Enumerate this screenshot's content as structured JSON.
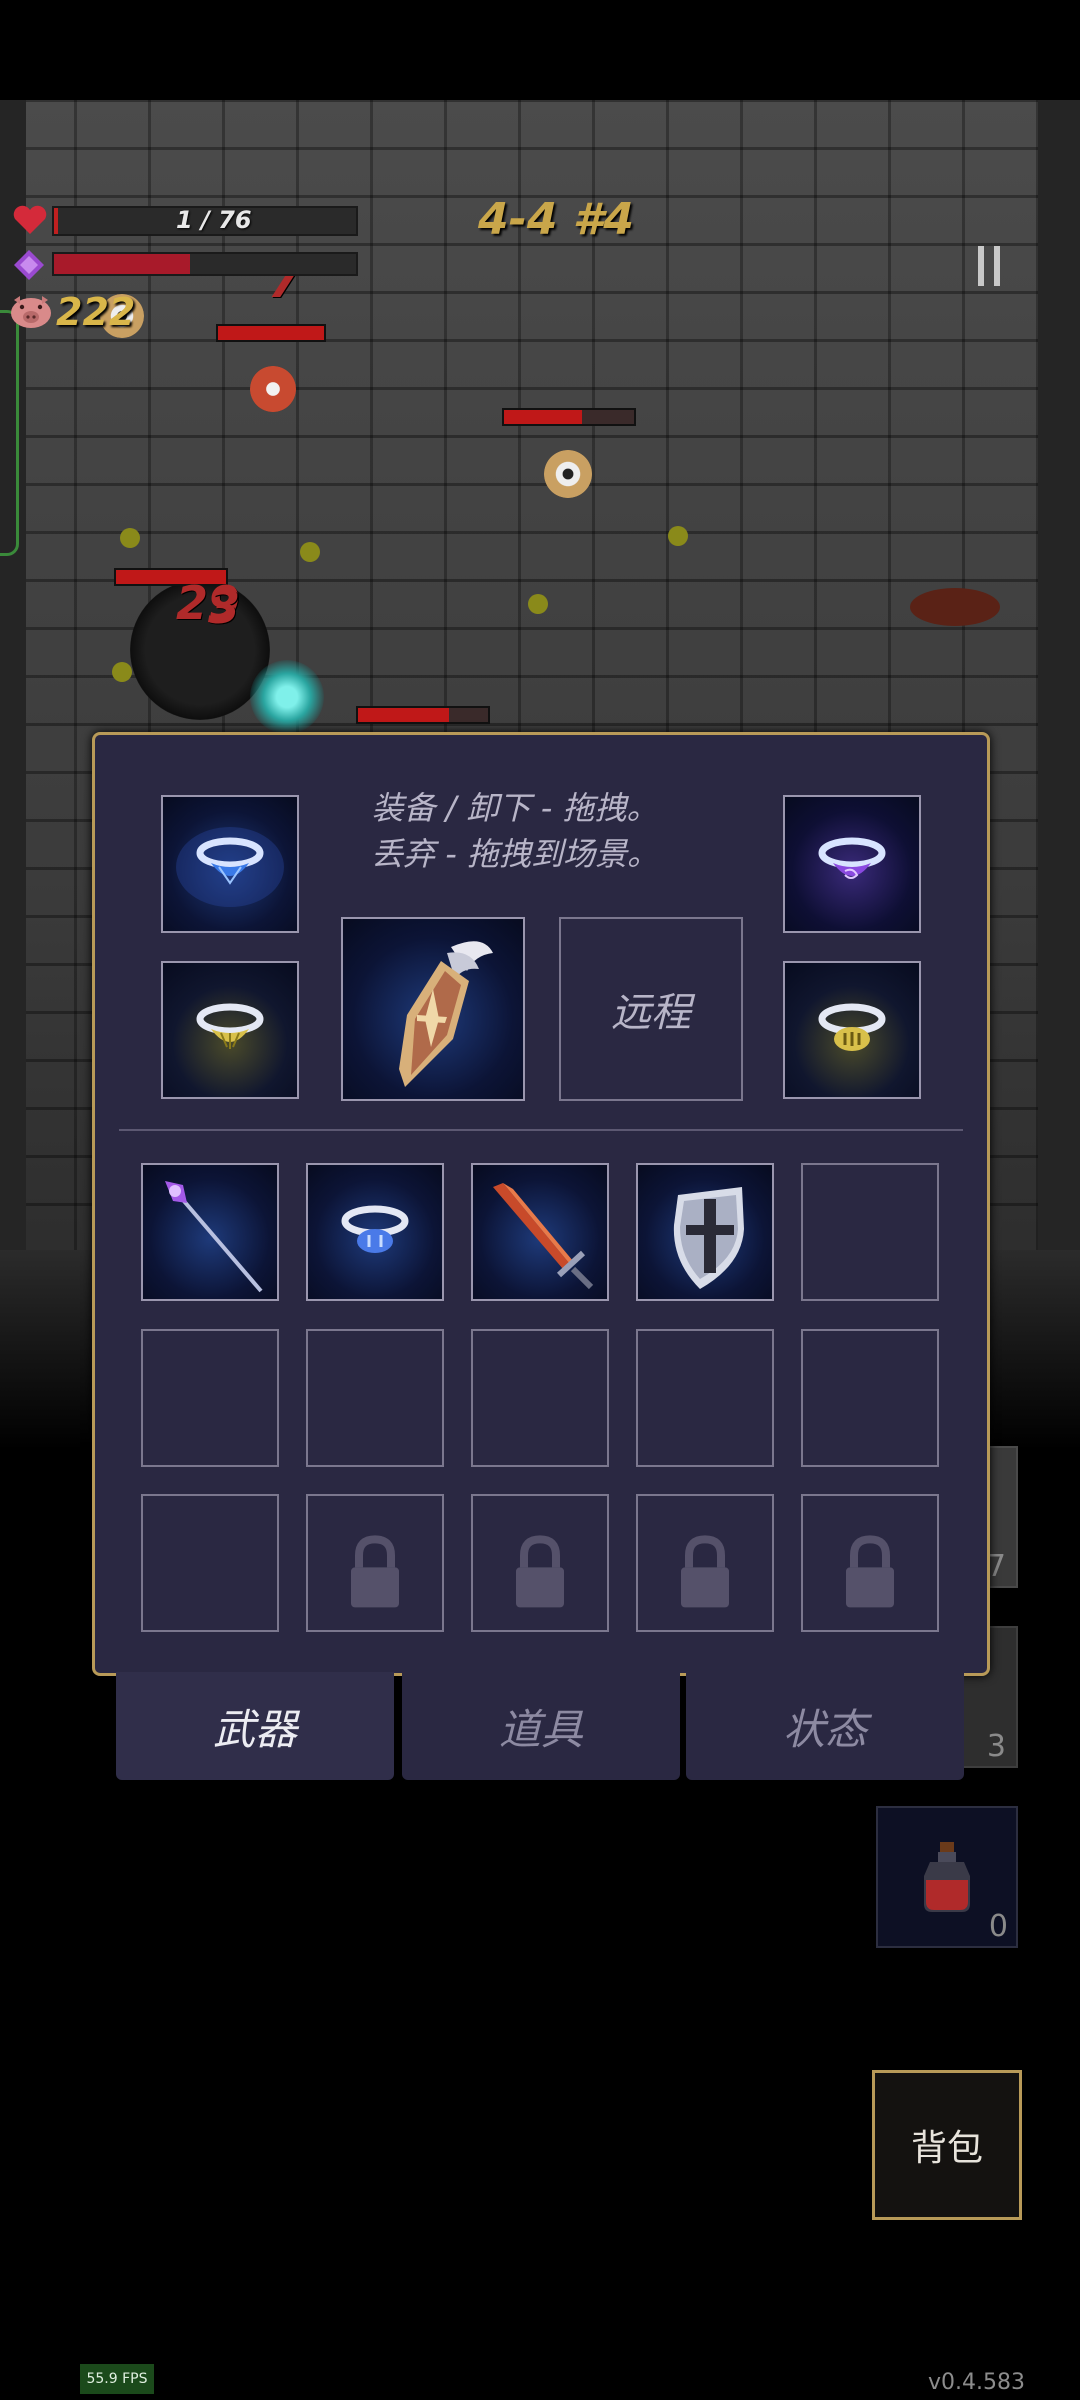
{
  "hud": {
    "hp_text": "1 / 76",
    "hp_fraction": 0.013,
    "mana_fraction": 0.45,
    "gold": "222",
    "level": "4-4 #4",
    "pause_icon": "pause-icon"
  },
  "scene": {
    "damage_numbers": [
      "7",
      "29",
      "3"
    ]
  },
  "inventory": {
    "hint_line1": "装备 / 卸下 - 拖拽。",
    "hint_line2": "丢弃 - 拖拽到场景。",
    "ranged_label": "远程",
    "equipped": [
      {
        "icon": "blue-gem-ring-icon"
      },
      {
        "icon": "purple-gem-ring-icon"
      },
      {
        "icon": "gold-gem-ring-icon"
      },
      {
        "icon": "gold-striped-ring-icon"
      },
      {
        "icon": "winged-shield-icon"
      }
    ],
    "items": [
      {
        "icon": "purple-staff-icon"
      },
      {
        "icon": "blue-striped-ring-icon"
      },
      {
        "icon": "red-sword-icon"
      },
      {
        "icon": "cross-shield-icon"
      }
    ],
    "locked_slots": 4
  },
  "tabs": [
    {
      "label": "武器",
      "active": true
    },
    {
      "label": "道具",
      "active": false
    },
    {
      "label": "状态",
      "active": false
    }
  ],
  "right_side": {
    "hidden_count_1": "7",
    "hidden_count_2": "3",
    "potion_count": "0"
  },
  "bag_button": "背包",
  "fps": "55.9 FPS",
  "version": "v0.4.583"
}
